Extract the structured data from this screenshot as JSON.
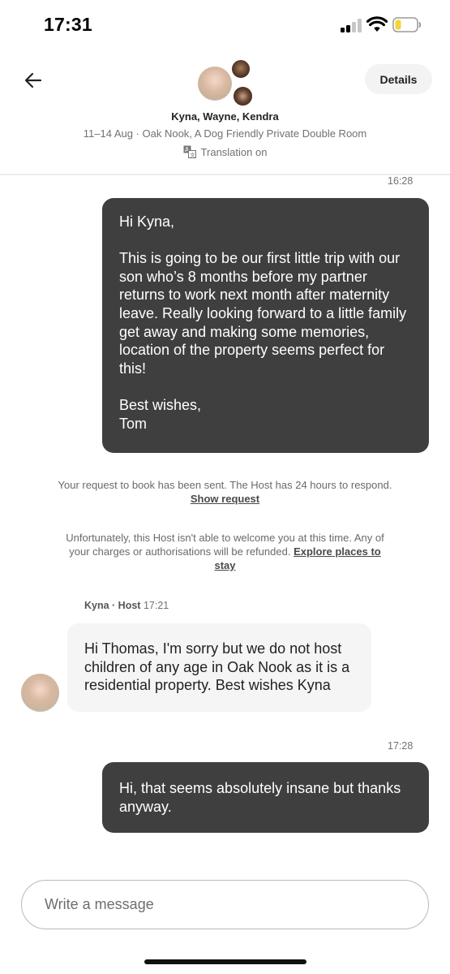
{
  "status_bar": {
    "time": "17:31",
    "icons": [
      "cellular-signal-icon",
      "wifi-icon",
      "battery-low-icon"
    ],
    "battery_color": "#f5d33b"
  },
  "header": {
    "back_icon": "arrow-left-icon",
    "details_label": "Details",
    "participants": "Kyna, Wayne, Kendra",
    "trip_info": "11–14 Aug · Oak Nook, A Dog Friendly Private Double Room",
    "translation_label": "Translation on",
    "translation_icon": "translate-icon"
  },
  "messages": {
    "first_time": "16:28",
    "first_text": "Hi Kyna,\n\nThis is going to be our first little trip with our son who’s 8 months before my partner returns to work next month after maternity leave. Really looking forward to a little family get away and making some memories, location of the property seems perfect for this!\n\nBest wishes,\nTom",
    "system1_text": "Your request to book has been sent. The Host has 24 hours to respond.",
    "system1_link": "Show request",
    "system2_text": "Unfortunately, this Host isn't able to welcome you at this time. Any of your charges or authorisations will be refunded.",
    "system2_link": "Explore places to stay",
    "host_name": "Kyna · Host",
    "host_time": "17:21",
    "host_text": "Hi Thomas, I'm sorry but we do not host children of any age in Oak Nook as it is a residential property. Best wishes Kyna",
    "reply_time": "17:28",
    "reply_text": "Hi, that seems absolutely insane but thanks anyway."
  },
  "compose": {
    "placeholder": "Write a message"
  },
  "colors": {
    "outgoing_bubble": "#3f3f3f",
    "incoming_bubble": "#f5f5f5",
    "muted_text": "#717171"
  }
}
